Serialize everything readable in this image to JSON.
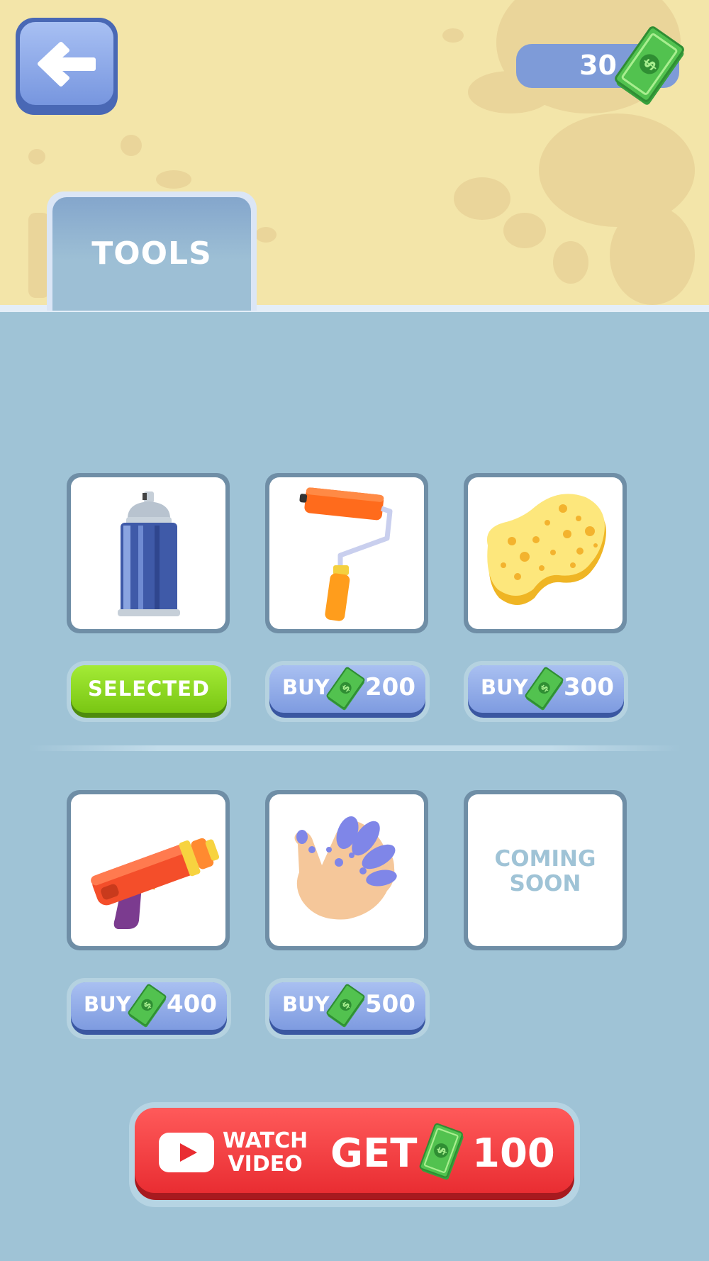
{
  "header": {
    "back_icon": "arrow-left-icon",
    "currency": {
      "value": "30",
      "icon": "cash-bill-icon"
    }
  },
  "tabs": [
    {
      "label": "TOOLS",
      "active": true
    }
  ],
  "tools": [
    {
      "icon": "spray-can-icon",
      "status": "selected",
      "button_label": "SELECTED"
    },
    {
      "icon": "paint-roller-icon",
      "status": "locked",
      "button_label": "BUY",
      "price": "200"
    },
    {
      "icon": "sponge-icon",
      "status": "locked",
      "button_label": "BUY",
      "price": "300"
    },
    {
      "icon": "water-gun-icon",
      "status": "locked",
      "button_label": "BUY",
      "price": "400"
    },
    {
      "icon": "painted-hand-icon",
      "status": "locked",
      "button_label": "BUY",
      "price": "500"
    },
    {
      "status": "coming_soon",
      "text_line1": "COMING",
      "text_line2": "SOON"
    }
  ],
  "reward_button": {
    "watch_line1": "WATCH",
    "watch_line2": "VIDEO",
    "get_label": "GET",
    "amount": "100",
    "icon": "play-video-icon"
  },
  "colors": {
    "background_top": "#f3e5a9",
    "panel": "#9fc3d6",
    "button_blue": "#7e9be0",
    "button_green": "#79c613",
    "button_red": "#e92d32",
    "cash_green": "#49b54a"
  }
}
